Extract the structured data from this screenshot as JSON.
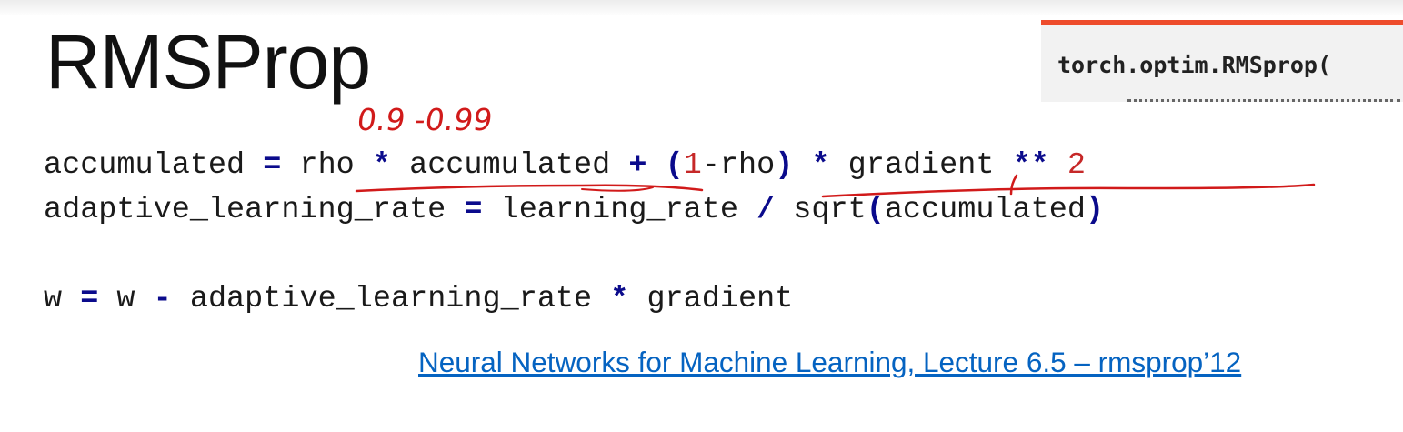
{
  "slide": {
    "title": "RMSProp",
    "doc_signature": "torch.optim.RMSprop(",
    "code": {
      "line1": {
        "a": "accumulated ",
        "op1": "=",
        "b": " rho ",
        "op2": "*",
        "c": " accumulated ",
        "op3": "+",
        "d": " ",
        "op4": "(",
        "num1": "1",
        "e": "-rho",
        "op5": ")",
        "f": " ",
        "op6": "*",
        "g": " gradient ",
        "op7": "**",
        "h": " ",
        "num2": "2"
      },
      "line2": {
        "a": "adaptive_learning_rate ",
        "op1": "=",
        "b": " learning_rate ",
        "op2": "/",
        "c": " sqrt",
        "op3": "(",
        "d": "accumulated",
        "op4": ")"
      },
      "line3": {
        "a": "w ",
        "op1": "=",
        "b": " w ",
        "op2": "-",
        "c": " adaptive_learning_rate ",
        "op3": "*",
        "d": " gradient"
      }
    },
    "reference_link": "Neural Networks for Machine Learning, Lecture 6.5 – rmsprop’12",
    "annotation": "0.9 -0.99"
  },
  "colors": {
    "operator": "#0b0b8c",
    "number": "#c62828",
    "annotation": "#d11a1a",
    "link": "#0563c1",
    "doc_border": "#ee4c2c"
  }
}
